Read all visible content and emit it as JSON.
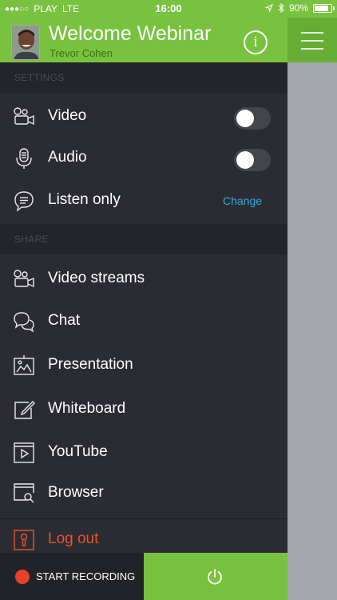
{
  "status_bar": {
    "carrier": "PLAY",
    "network": "LTE",
    "time": "16:00",
    "battery": "90%",
    "battery_level": 0.9
  },
  "header": {
    "title": "Welcome Webinar",
    "user_name": "Trevor Cohen",
    "info_icon": "info-icon",
    "menu_icon": "hamburger-icon"
  },
  "colors": {
    "brand_green": "#78c23f",
    "drawer_bg": "#2b2c33",
    "section_bg": "#24252b",
    "link_blue": "#3aa7db",
    "logout_red": "#e8532a",
    "record_red": "#e8402a"
  },
  "settings": {
    "header": "SETTINGS",
    "items": [
      {
        "label": "Video",
        "icon": "video-camera-icon",
        "control": "toggle",
        "on": false
      },
      {
        "label": "Audio",
        "icon": "microphone-icon",
        "control": "toggle",
        "on": false
      },
      {
        "label": "Listen only",
        "icon": "speech-bubble-icon",
        "action": "Change"
      }
    ]
  },
  "share": {
    "header": "SHARE",
    "items": [
      {
        "label": "Video streams",
        "icon": "video-streams-icon"
      },
      {
        "label": "Chat",
        "icon": "chat-icon"
      },
      {
        "label": "Presentation",
        "icon": "presentation-icon"
      },
      {
        "label": "Whiteboard",
        "icon": "whiteboard-icon"
      },
      {
        "label": "YouTube",
        "icon": "youtube-icon"
      },
      {
        "label": "Browser",
        "icon": "browser-icon"
      }
    ]
  },
  "logout": {
    "label": "Log out",
    "icon": "logout-icon"
  },
  "footer": {
    "record_label": "START RECORDING",
    "power_icon": "power-icon"
  }
}
